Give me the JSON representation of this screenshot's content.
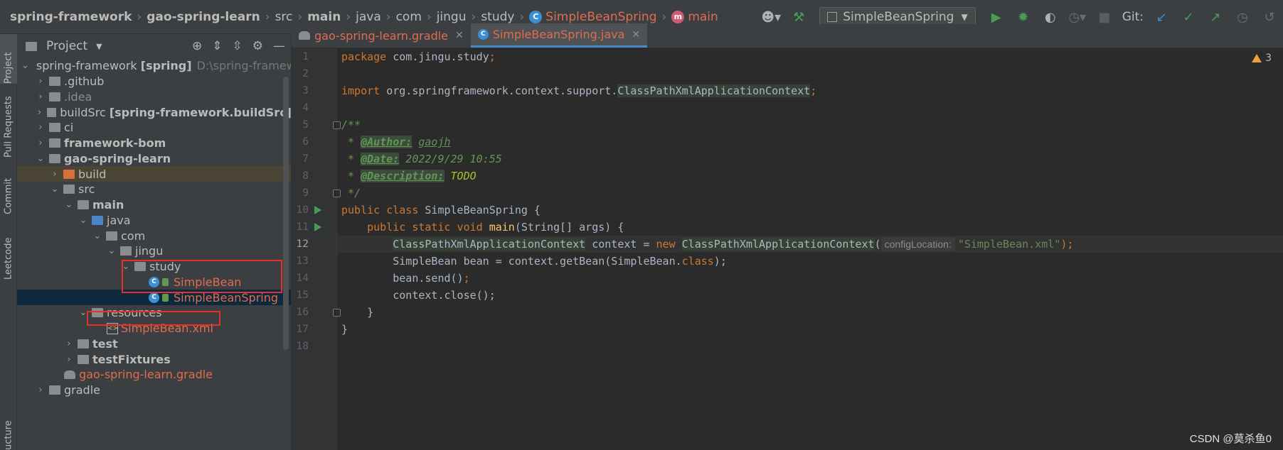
{
  "breadcrumbs": [
    {
      "label": "spring-framework",
      "bold": true
    },
    {
      "label": "gao-spring-learn",
      "bold": true
    },
    {
      "label": "src"
    },
    {
      "label": "main",
      "bold": true
    },
    {
      "label": "java"
    },
    {
      "label": "com"
    },
    {
      "label": "jingu"
    },
    {
      "label": "study"
    },
    {
      "label": "SimpleBeanSpring",
      "icon": "class-icon",
      "orange": true
    },
    {
      "label": "main",
      "icon": "method-icon",
      "orange": true
    }
  ],
  "toolbar": {
    "run_config": "SimpleBeanSpring",
    "git_label": "Git:"
  },
  "side_tabs": [
    "Project",
    "Pull Requests",
    "Commit",
    "Leetcode",
    "ucture"
  ],
  "project_panel": {
    "title": "Project",
    "tree": [
      {
        "label": "spring-framework",
        "suffix": "[spring]",
        "path": "D:\\spring-framework",
        "arrow": "down",
        "icon": "module-folder",
        "indent": 0
      },
      {
        "label": ".github",
        "arrow": "right",
        "icon": "folder",
        "indent": 1
      },
      {
        "label": ".idea",
        "arrow": "right",
        "icon": "folder",
        "indent": 1,
        "dim": true
      },
      {
        "label": "buildSrc",
        "suffix": "[spring-framework.buildSrc]",
        "arrow": "right",
        "icon": "module-folder",
        "indent": 1
      },
      {
        "label": "ci",
        "arrow": "right",
        "icon": "folder",
        "indent": 1
      },
      {
        "label": "framework-bom",
        "arrow": "right",
        "icon": "module-folder",
        "indent": 1,
        "bold": true
      },
      {
        "label": "gao-spring-learn",
        "arrow": "down",
        "icon": "module-folder",
        "indent": 1,
        "bold": true
      },
      {
        "label": "build",
        "arrow": "right",
        "icon": "orange-folder",
        "indent": 2
      },
      {
        "label": "src",
        "arrow": "down",
        "icon": "folder",
        "indent": 2
      },
      {
        "label": "main",
        "arrow": "down",
        "icon": "folder",
        "indent": 3,
        "bold": true
      },
      {
        "label": "java",
        "arrow": "down",
        "icon": "blue-folder",
        "indent": 4
      },
      {
        "label": "com",
        "arrow": "down",
        "icon": "package",
        "indent": 5
      },
      {
        "label": "jingu",
        "arrow": "down",
        "icon": "package",
        "indent": 6
      },
      {
        "label": "study",
        "arrow": "down",
        "icon": "package",
        "indent": 7
      },
      {
        "label": "SimpleBean",
        "icon": "class",
        "indent": 8,
        "orange": true
      },
      {
        "label": "SimpleBeanSpring",
        "icon": "class-run",
        "indent": 8,
        "orange": true
      },
      {
        "label": "resources",
        "arrow": "down",
        "icon": "res-folder",
        "indent": 4
      },
      {
        "label": "SimpleBean.xml",
        "icon": "xml",
        "indent": 5,
        "orange": true
      },
      {
        "label": "test",
        "arrow": "right",
        "icon": "folder",
        "indent": 3,
        "bold": true
      },
      {
        "label": "testFixtures",
        "arrow": "right",
        "icon": "folder",
        "indent": 3,
        "bold": true
      },
      {
        "label": "gao-spring-learn.gradle",
        "icon": "gradle",
        "indent": 2,
        "orange": true
      },
      {
        "label": "gradle",
        "arrow": "right",
        "icon": "folder",
        "indent": 1
      }
    ]
  },
  "editor": {
    "tabs": [
      {
        "label": "gao-spring-learn.gradle",
        "icon": "gradle"
      },
      {
        "label": "SimpleBeanSpring.java",
        "icon": "class",
        "active": true
      }
    ],
    "line_numbers": [
      "1",
      "2",
      "3",
      "4",
      "5",
      "6",
      "7",
      "8",
      "9",
      "10",
      "11",
      "12",
      "13",
      "14",
      "15",
      "16",
      "17",
      "18"
    ],
    "lines": {
      "l1_kw": "package",
      "l1_rest": " com.jingu.study",
      "l1_semi": ";",
      "l3_kw": "import",
      "l3_pkg": " org.springframework.context.support.",
      "l3_cls": "ClassPathXmlApplicationContext",
      "l3_semi": ";",
      "l5": "/**",
      "l6_pre": " * ",
      "l6_tag": "@Author:",
      "l6_val": "gaojh",
      "l7_pre": " * ",
      "l7_tag": "@Date:",
      "l7_val": " 2022/9/29 10:55",
      "l8_pre": " * ",
      "l8_tag": "@Description:",
      "l8_val": "TODO",
      "l9": " */",
      "l10_kw": "public class",
      "l10_rest": " SimpleBeanSpring {",
      "l11_indent": "    ",
      "l11_kw": "public static void",
      "l11_fn": "main",
      "l11_rest": "(String[] args) {",
      "l12_indent": "        ",
      "l12_cls": "ClassPathXmlApplicationContext",
      "l12_mid": " context = ",
      "l12_new": "new",
      "l12_cls2": "ClassPathXmlApplicationContext",
      "l12_paren": "(",
      "l12_hint": "configLocation:",
      "l12_str": "\"SimpleBean.xml\"",
      "l12_end": ");",
      "l13_a": "        SimpleBean bean = context.getBean(SimpleBean.",
      "l13_kw": "class",
      "l13_end": ");",
      "l14_a": "        bean.send()",
      "l14_semi": ";",
      "l15": "        context.close();",
      "l16": "    }",
      "l17": "}"
    },
    "warning_count": "3"
  },
  "watermark": "CSDN @莫杀鱼0",
  "colors": {
    "keyword": "#cc7832",
    "doc_comment": "#629755",
    "string": "#6a8759",
    "function": "#ffc66d",
    "orange_file": "#e06c4f",
    "red_box": "#e8312f"
  }
}
